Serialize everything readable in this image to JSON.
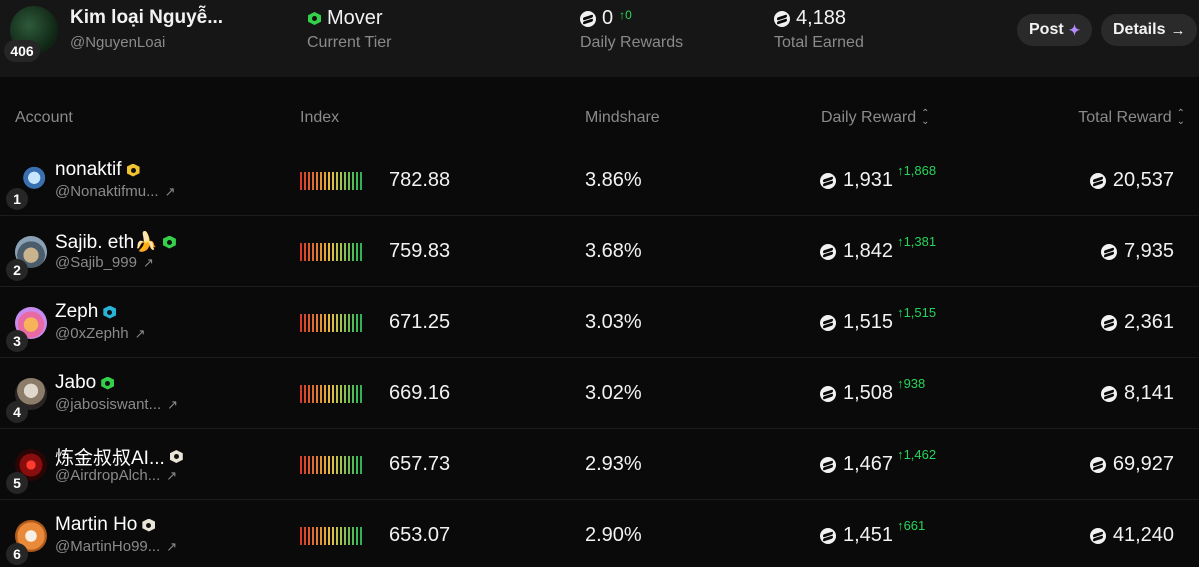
{
  "me": {
    "name": "Kim loại Nguyễ...",
    "handle": "@NguyenLoai",
    "rank": "406",
    "tier_value": "Mover",
    "tier_label": "Current Tier",
    "daily_rewards_value": "0",
    "daily_rewards_delta": "↑0",
    "daily_rewards_label": "Daily Rewards",
    "total_earned_value": "4,188",
    "total_earned_label": "Total Earned"
  },
  "buttons": {
    "post": "Post",
    "details": "Details"
  },
  "columns": {
    "account": "Account",
    "index": "Index",
    "mindshare": "Mindshare",
    "daily_reward": "Daily Reward",
    "total_reward": "Total Reward"
  },
  "colors": {
    "badge_gold": "#f1c232",
    "badge_green": "#35d04a",
    "badge_blue": "#27b4d8",
    "badge_white": "#e8e4d6",
    "delta_green": "#27d45a"
  },
  "rows": [
    {
      "rank": "1",
      "name": "nonaktif",
      "handle": "@Nonaktifmu...",
      "badge": "gold",
      "index": "782.88",
      "mindshare": "3.86%",
      "daily": "1,931",
      "delta": "↑1,868",
      "total": "20,537"
    },
    {
      "rank": "2",
      "name": "Sajib. eth🍌",
      "handle": "@Sajib_999",
      "badge": "green",
      "index": "759.83",
      "mindshare": "3.68%",
      "daily": "1,842",
      "delta": "↑1,381",
      "total": "7,935"
    },
    {
      "rank": "3",
      "name": "Zeph",
      "handle": "@0xZephh",
      "badge": "blue",
      "index": "671.25",
      "mindshare": "3.03%",
      "daily": "1,515",
      "delta": "↑1,515",
      "total": "2,361"
    },
    {
      "rank": "4",
      "name": "Jabo",
      "handle": "@jabosiswant...",
      "badge": "green",
      "index": "669.16",
      "mindshare": "3.02%",
      "daily": "1,508",
      "delta": "↑938",
      "total": "8,141"
    },
    {
      "rank": "5",
      "name": "炼金叔叔AI...",
      "handle": "@AirdropAlch...",
      "badge": "white",
      "index": "657.73",
      "mindshare": "2.93%",
      "daily": "1,467",
      "delta": "↑1,462",
      "total": "69,927"
    },
    {
      "rank": "6",
      "name": "Martin Ho",
      "handle": "@MartinHo99...",
      "badge": "white",
      "index": "653.07",
      "mindshare": "2.90%",
      "daily": "1,451",
      "delta": "↑661",
      "total": "41,240"
    }
  ]
}
